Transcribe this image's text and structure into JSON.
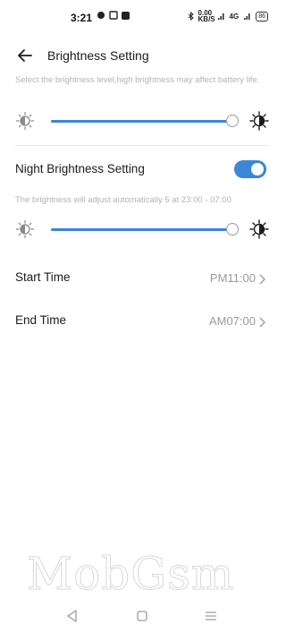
{
  "status_bar": {
    "time": "3:21",
    "left_icons": [
      "whatsapp-icon",
      "sim-icon",
      "notification-icon"
    ],
    "right_icons": [
      "bluetooth-icon",
      "data-speed-icon",
      "signal-icon",
      "wifi-icon"
    ],
    "data_speed": "0.00 KB/S",
    "network": "4G",
    "battery": "86"
  },
  "header": {
    "back_icon": "back-arrow-icon",
    "title": "Brightness Setting"
  },
  "brightness": {
    "description": "Select the brightness level,high brightness may affect battery life.",
    "level": 0.985,
    "min_icon": "brightness-low-icon",
    "max_icon": "brightness-high-icon"
  },
  "night": {
    "label": "Night Brightness Setting",
    "enabled": true,
    "description": "The brightness will adjust automatically 5 at 23:00 - 07:00",
    "level": 0.985
  },
  "schedule": {
    "start_label": "Start Time",
    "start_value": "PM11:00",
    "end_label": "End Time",
    "end_value": "AM07:00"
  },
  "watermark": "MobGsm",
  "colors": {
    "accent": "#3a86d9",
    "track": "#d9d9d9",
    "secondary_text": "#9b9b9b"
  },
  "navigation": [
    "back-nav-icon",
    "home-nav-icon",
    "menu-nav-icon"
  ]
}
